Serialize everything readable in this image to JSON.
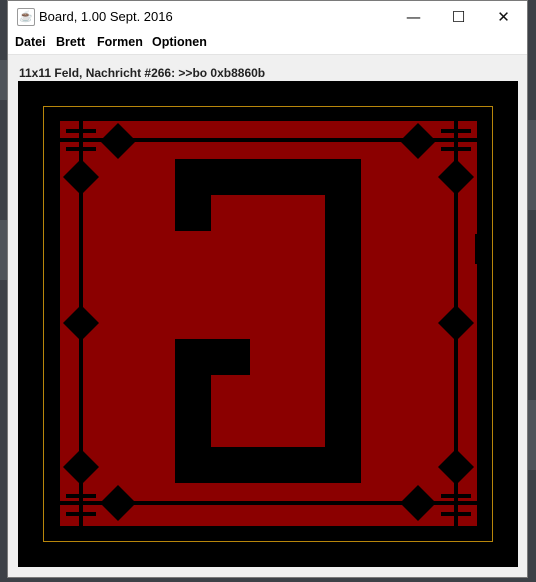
{
  "window": {
    "title": "Board, 1.00 Sept. 2016",
    "minimize_glyph": "—",
    "maximize_glyph": "☐",
    "close_glyph": "✕",
    "app_icon": "java-cup-icon"
  },
  "menu": {
    "items": [
      "Datei",
      "Brett",
      "Formen",
      "Optionen"
    ]
  },
  "status_text": "11x11 Feld, Nachricht #266: >>bo 0xb8860b",
  "colors": {
    "board_bg": "#000000",
    "board_fill": "#8b0000",
    "frame_line": "#b8860b"
  }
}
